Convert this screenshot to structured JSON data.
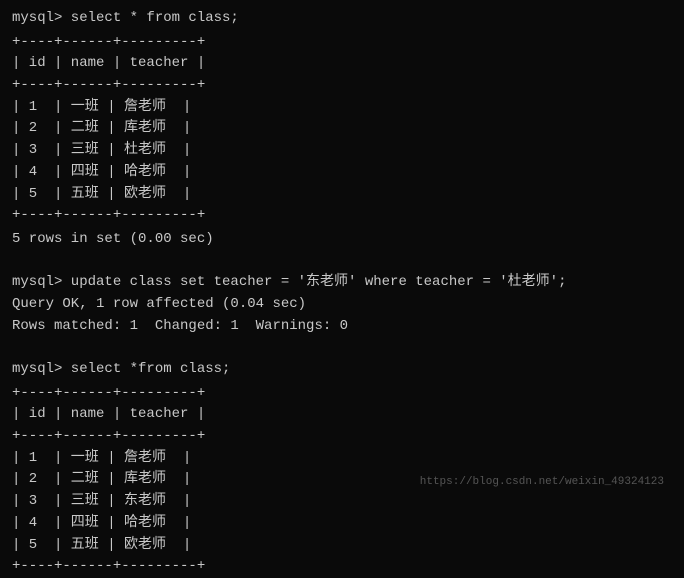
{
  "terminal": {
    "background": "#0a0a0a",
    "text_color": "#c8c8c8"
  },
  "content": {
    "block1": {
      "prompt": "mysql> select * from class;",
      "table1": {
        "border_top": "+----+------+---------+",
        "header": "| id | name | teacher |",
        "border_mid": "+----+------+---------+",
        "rows": [
          "| 1  | 一班 | 詹老师  |",
          "| 2  | 二班 | 库老师  |",
          "| 3  | 三班 | 杜老师  |",
          "| 4  | 四班 | 哈老师  |",
          "| 5  | 五班 | 欧老师  |"
        ],
        "border_bottom": "+----+------+---------+"
      },
      "result": "5 rows in set (0.00 sec)"
    },
    "block2": {
      "prompt": "mysql> update class set teacher = '东老师' where teacher = '杜老师';",
      "line1": "Query OK, 1 row affected (0.04 sec)",
      "line2": "Rows matched: 1  Changed: 1  Warnings: 0"
    },
    "block3": {
      "prompt": "mysql> select *from class;",
      "table2": {
        "border_top": "+----+------+---------+",
        "header": "| id | name | teacher |",
        "border_mid": "+----+------+---------+",
        "rows": [
          "| 1  | 一班 | 詹老师  |",
          "| 2  | 二班 | 库老师  |",
          "| 3  | 三班 | 东老师  |",
          "| 4  | 四班 | 哈老师  |",
          "| 5  | 五班 | 欧老师  |"
        ],
        "border_bottom": "+----+------+---------+"
      }
    },
    "watermark": "https://blog.csdn.net/weixin_49324123"
  }
}
